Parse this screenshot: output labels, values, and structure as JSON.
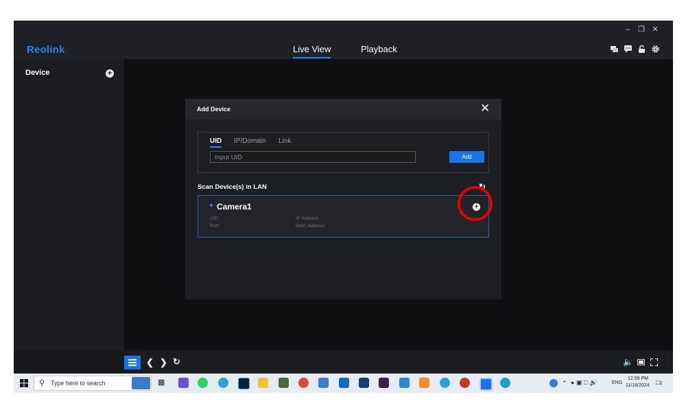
{
  "app": {
    "logo": "Reolink",
    "nav_tabs": [
      {
        "label": "Live View",
        "active": true
      },
      {
        "label": "Playback",
        "active": false
      }
    ],
    "window_controls": [
      "minimize-icon",
      "restore-icon",
      "close-icon"
    ],
    "toolbar_icons": [
      "chat-icon",
      "message-icon",
      "lock-icon",
      "gear-icon"
    ]
  },
  "sidebar": {
    "title": "Device"
  },
  "dialog": {
    "title": "Add Device",
    "tabs": [
      {
        "label": "UID",
        "active": true
      },
      {
        "label": "IP/Domain",
        "active": false
      },
      {
        "label": "Link",
        "active": false
      }
    ],
    "uid_input_placeholder": "Input UID",
    "add_button": "Add",
    "scan_title": "Scan Device(s) in LAN",
    "device": {
      "name": "Camera1",
      "uid_label": "UID",
      "port_label": "Port",
      "ip_label": "IP Address",
      "mac_label": "MAC Address"
    }
  },
  "taskbar": {
    "search_placeholder": "Type here to search",
    "language": "ENG",
    "time": "12:59 PM",
    "date": "11/18/2024",
    "notification_count": "2"
  },
  "colors": {
    "accent": "#2a7ff6",
    "highlight_ring": "#e50000",
    "background": "#17181c"
  }
}
